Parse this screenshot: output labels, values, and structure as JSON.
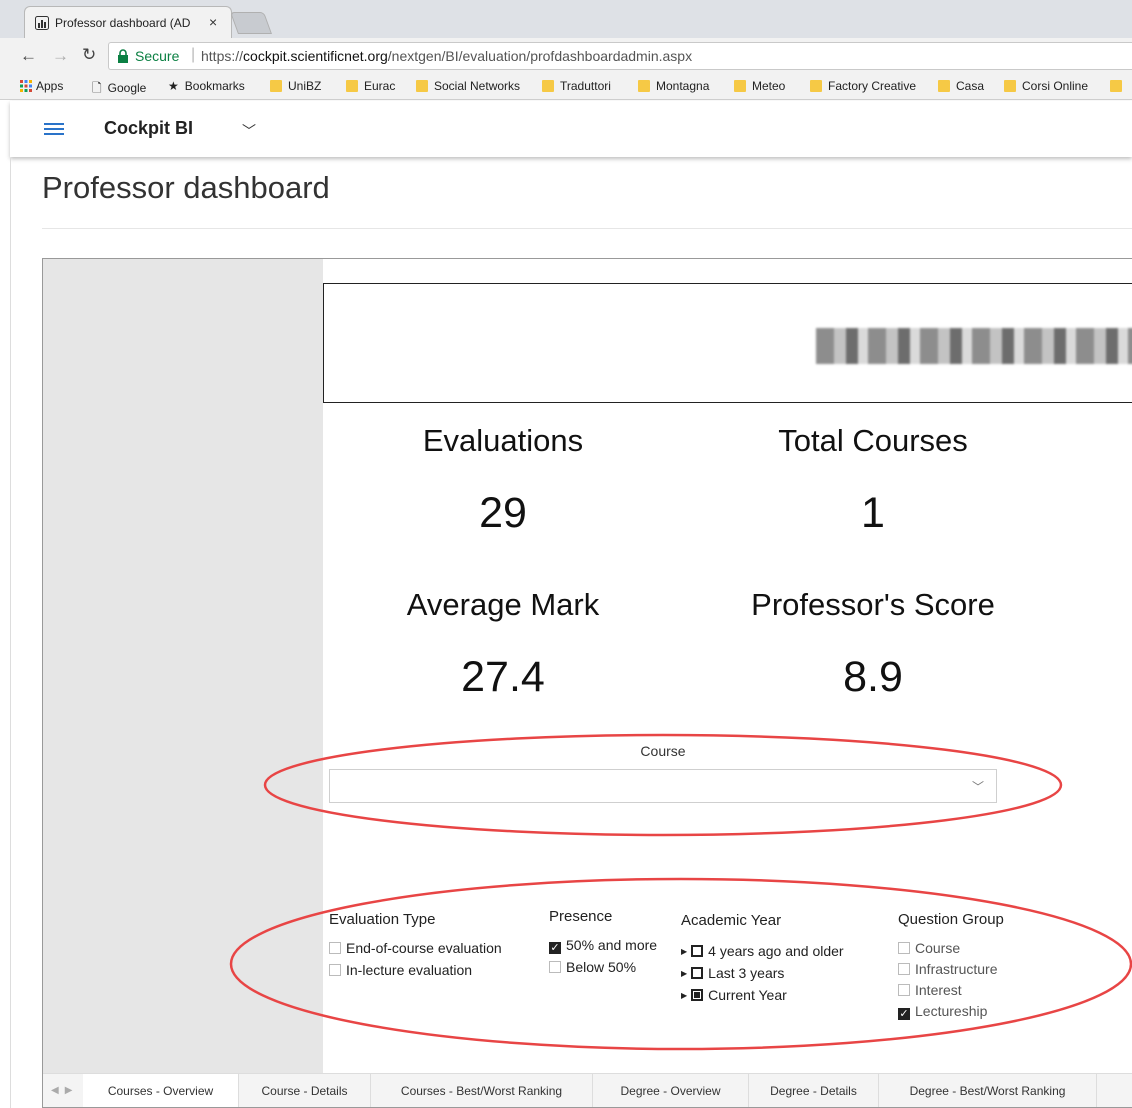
{
  "browser": {
    "tab_title": "Professor dashboard (AD",
    "tab_close": "×",
    "secure_label": "Secure",
    "url_prefix": "https://",
    "url_host": "cockpit.scientificnet.org",
    "url_path": "/nextgen/BI/evaluation/profdashboardadmin.aspx",
    "bookmarks": [
      "Apps",
      "Google",
      "Bookmarks",
      "UniBZ",
      "Eurac",
      "Social Networks",
      "Traduttori",
      "Montagna",
      "Meteo",
      "Factory Creative",
      "Casa",
      "Corsi Online"
    ]
  },
  "app": {
    "title": "Cockpit BI"
  },
  "page": {
    "title": "Professor dashboard"
  },
  "kpis": {
    "evaluations_label": "Evaluations",
    "evaluations_value": "29",
    "total_courses_label": "Total Courses",
    "total_courses_value": "1",
    "average_mark_label": "Average Mark",
    "average_mark_value": "27.4",
    "professor_score_label": "Professor's Score",
    "professor_score_value": "8.9"
  },
  "course_filter": {
    "label": "Course",
    "selected": ""
  },
  "filters": {
    "evaluation_type": {
      "title": "Evaluation Type",
      "options": [
        "End-of-course evaluation",
        "In-lecture evaluation"
      ]
    },
    "presence": {
      "title": "Presence",
      "options": [
        "50% and more",
        "Below 50%"
      ]
    },
    "academic_year": {
      "title": "Academic Year",
      "options": [
        "4 years ago and older",
        "Last 3 years",
        "Current Year"
      ]
    },
    "question_group": {
      "title": "Question Group",
      "options": [
        "Course",
        "Infrastructure",
        "Interest",
        "Lectureship"
      ]
    }
  },
  "report_tabs": [
    "Courses - Overview",
    "Course - Details",
    "Courses - Best/Worst Ranking",
    "Degree - Overview",
    "Degree - Details",
    "Degree - Best/Worst Ranking"
  ],
  "colors": {
    "annotation": "#e84545",
    "accent": "#2a73c9",
    "tab_indicator": "#f2c811"
  }
}
